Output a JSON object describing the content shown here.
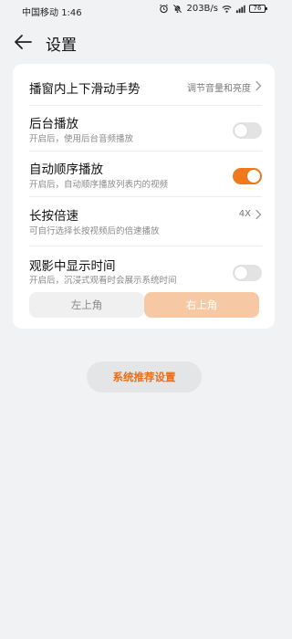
{
  "status": {
    "carrier": "中国移动",
    "time": "1:46",
    "speed": "203B/s",
    "battery": "76"
  },
  "header": {
    "title": "设置"
  },
  "settings": {
    "gesture": {
      "title": "播窗内上下滑动手势",
      "value": "调节音量和亮度"
    },
    "background": {
      "title": "后台播放",
      "sub": "开启后，使用后台音频播放",
      "state": "off"
    },
    "autoplay": {
      "title": "自动顺序播放",
      "sub": "开启后，自动顺序播放列表内的视频",
      "state": "on"
    },
    "speed": {
      "title": "长按倍速",
      "sub": "可自行选择长按视频后的倍速播放",
      "value": "4X"
    },
    "showtime": {
      "title": "观影中显示时间",
      "sub": "开启后，沉浸式观看时会展示系统时间",
      "state": "off"
    },
    "position": {
      "left": "左上角",
      "right": "右上角",
      "selected": "right"
    }
  },
  "footer": {
    "recommend": "系统推荐设置"
  },
  "colors": {
    "accent": "#f0791d",
    "accent_light": "#f6c8a3",
    "background": "#f1f2f4"
  }
}
